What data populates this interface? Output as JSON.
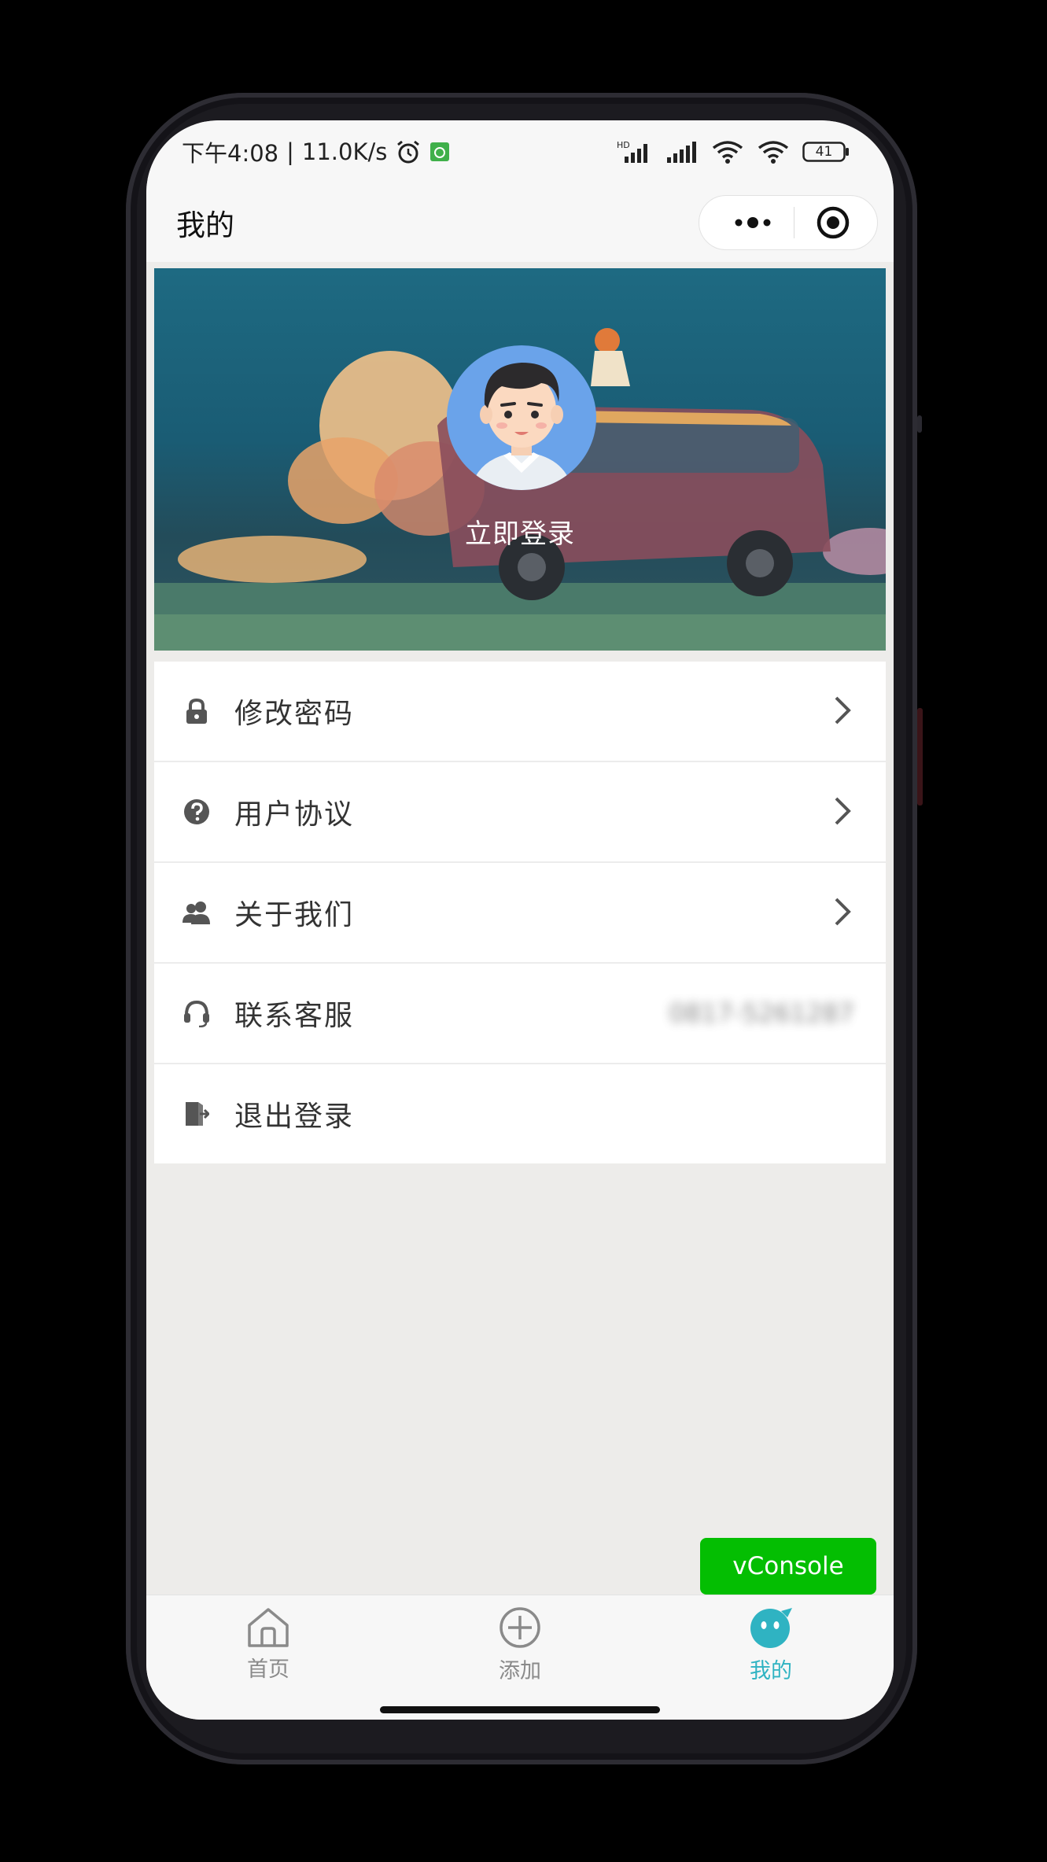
{
  "status_bar": {
    "time": "下午4:08",
    "separator": "|",
    "net_speed": "11.0K/s",
    "battery": "41",
    "hd_label": "HD"
  },
  "nav": {
    "title": "我的"
  },
  "profile": {
    "login_label": "立即登录"
  },
  "menu": [
    {
      "label": "修改密码",
      "icon": "lock-icon",
      "has_arrow": true
    },
    {
      "label": "用户协议",
      "icon": "question-circle-icon",
      "has_arrow": true
    },
    {
      "label": "关于我们",
      "icon": "users-icon",
      "has_arrow": true
    },
    {
      "label": "联系客服",
      "icon": "headset-icon",
      "has_arrow": false,
      "value": "0817-5261287"
    },
    {
      "label": "退出登录",
      "icon": "logout-door-icon",
      "has_arrow": false
    }
  ],
  "vconsole": {
    "label": "vConsole"
  },
  "tabbar": {
    "items": [
      {
        "label": "首页",
        "icon": "home-icon"
      },
      {
        "label": "添加",
        "icon": "add-circle-icon"
      },
      {
        "label": "我的",
        "icon": "profile-face-icon",
        "active": true
      }
    ]
  },
  "colors": {
    "accent": "#2fb3c2",
    "vconsole_green": "#04be02",
    "page_bg": "#edecea"
  }
}
